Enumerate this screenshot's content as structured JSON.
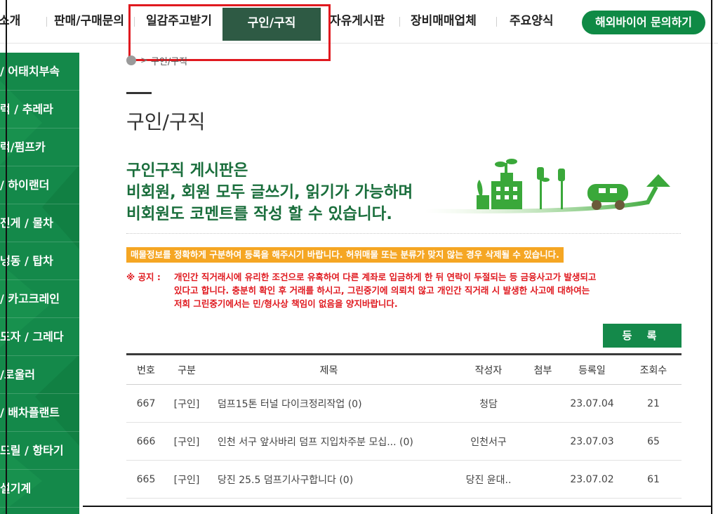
{
  "nav": {
    "items": [
      "소개",
      "판매/구매문의",
      "일감주고받기",
      "구인/구직",
      "자유게시판",
      "장비매매업체",
      "주요양식"
    ],
    "cta": "해외바이어 문의하기",
    "active_color": "#2e5a44",
    "accent_color": "#0f8a45"
  },
  "sidebar": {
    "items": [
      "/ 어태치부속",
      "럭 / 추레라",
      "럭/펌프카",
      "/ 하이랜더",
      "진게 / 물차",
      "냉동 / 탑차",
      "/ 카고크레인",
      "도자 / 그레다",
      "/로울러",
      "/ 배차플랜트",
      "드릴 / 항타기",
      "설기계"
    ],
    "color": "#14894a"
  },
  "breadcrumb": {
    "text": "구인/구직"
  },
  "page": {
    "title": "구인/구직",
    "intro_lines": [
      "구인구직 게시판은",
      "비회원, 회원 모두 글쓰기, 읽기가 가능하며",
      "비회원도 코멘트를 작성 할 수 있습니다."
    ],
    "notice_orange": "매물정보를 정확하게 구분하여 등록을 해주시기 바랍니다. 허위매물 또는 분류가 맞지 않는 경우 삭제될 수 있습니다.",
    "notice_label": "※ 공지 :",
    "notice_lines": [
      "개인간 직거래시에 유리한 조건으로 유혹하여 다른 계좌로 입금하게 한 뒤 연락이 두절되는 등 금융사고가 발생되고",
      "있다고 합니다. 충분히 확인 후 거래를 하시고, 그린중기에 의뢰치 않고 개인간 직거래 시 발생한 사고에 대하여는",
      "저희 그린중기에서는 민/형사상 책임이 없음을 양지바랍니다."
    ],
    "register_button": "등 록"
  },
  "table": {
    "headers": {
      "num": "번호",
      "category": "구분",
      "title": "제목",
      "author": "작성자",
      "attach": "첨부",
      "date": "등록일",
      "views": "조회수"
    },
    "rows": [
      {
        "num": "667",
        "category": "[구인]",
        "title": "덤프15톤 터널 다이크정리작업 (0)",
        "author": "청담",
        "attach": "",
        "date": "23.07.04",
        "views": "21"
      },
      {
        "num": "666",
        "category": "[구인]",
        "title": "인천 서구 앞사바리 덤프 지입차주분 모십... (0)",
        "author": "인천서구",
        "attach": "",
        "date": "23.07.03",
        "views": "65"
      },
      {
        "num": "665",
        "category": "[구인]",
        "title": "당진 25.5 덤프기사구합니다 (0)",
        "author": "당진 윤대..",
        "attach": "",
        "date": "23.07.02",
        "views": "61"
      }
    ]
  },
  "annotation_color": "#e0191f"
}
